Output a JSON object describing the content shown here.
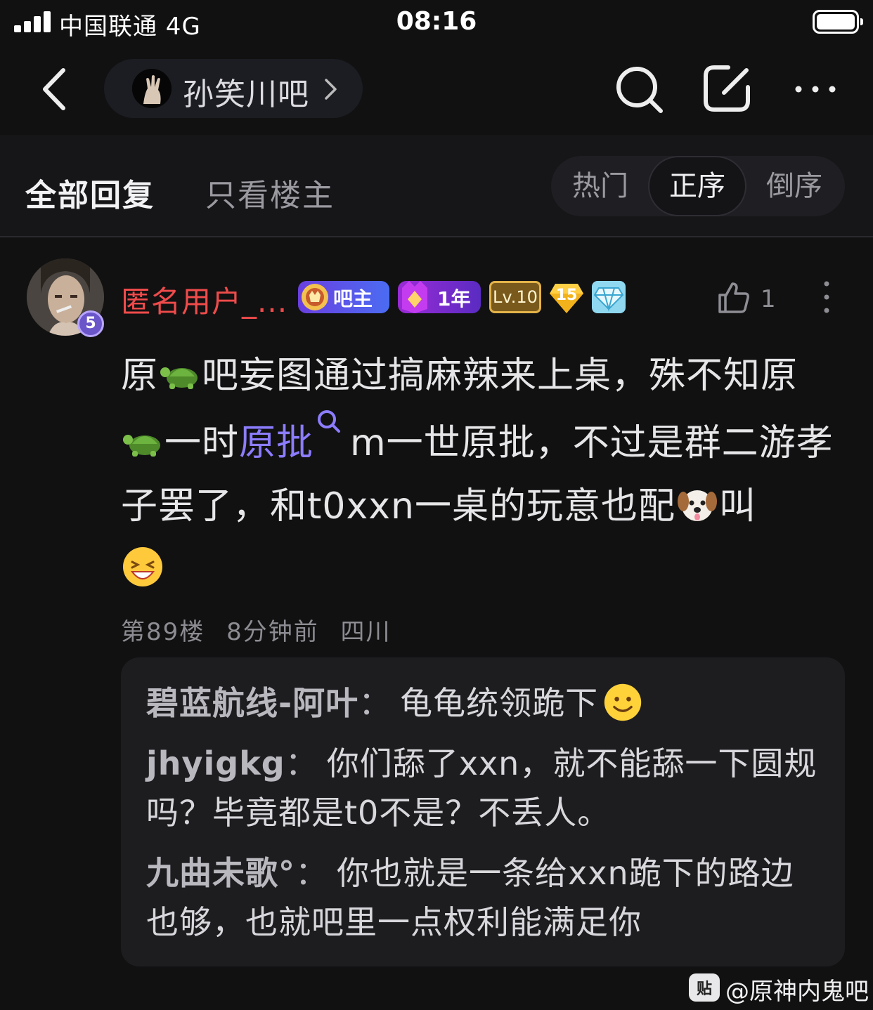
{
  "status": {
    "carrier": "中国联通  4G",
    "time": "08:16"
  },
  "nav": {
    "forum_name": "孙笑川吧"
  },
  "tabs": {
    "all": "全部回复",
    "owner_only": "只看楼主",
    "sort": [
      "热门",
      "正序",
      "倒序"
    ],
    "active_sort": "正序"
  },
  "post": {
    "username": "匿名用户_...",
    "level_badge": "5",
    "badges": {
      "admin": "吧主",
      "years": "1年",
      "level": "Lv.10",
      "count": "15"
    },
    "likes": "1",
    "body": {
      "p1": "原",
      "p2": "吧妄图通过搞麻辣来上桌，殊不知原",
      "p3": "一时",
      "link": "原批",
      "p4": "m一世原批，不过是群二游孝子罢了，和t0xxn一桌的玩意也配",
      "p5": "叫"
    },
    "meta": "第89楼  8分钟前  四川"
  },
  "replies": [
    {
      "name": "碧蓝航线-阿叶",
      "text": "龟龟统领跪下",
      "emoji": "smile"
    },
    {
      "name": "jhyigkg",
      "text": "你们舔了xxn，就不能舔一下圆规吗？毕竟都是t0不是？不丢人。"
    },
    {
      "name": "九曲未歌°",
      "text": "你也就是一条给xxn跪下的路边也够，也就吧里一点权利能满足你"
    }
  ],
  "watermark": {
    "logo": "贴",
    "text": "@原神内鬼吧"
  },
  "colors": {
    "username": "#ef4b4b",
    "link": "#8c7dff",
    "background": "#111112"
  }
}
